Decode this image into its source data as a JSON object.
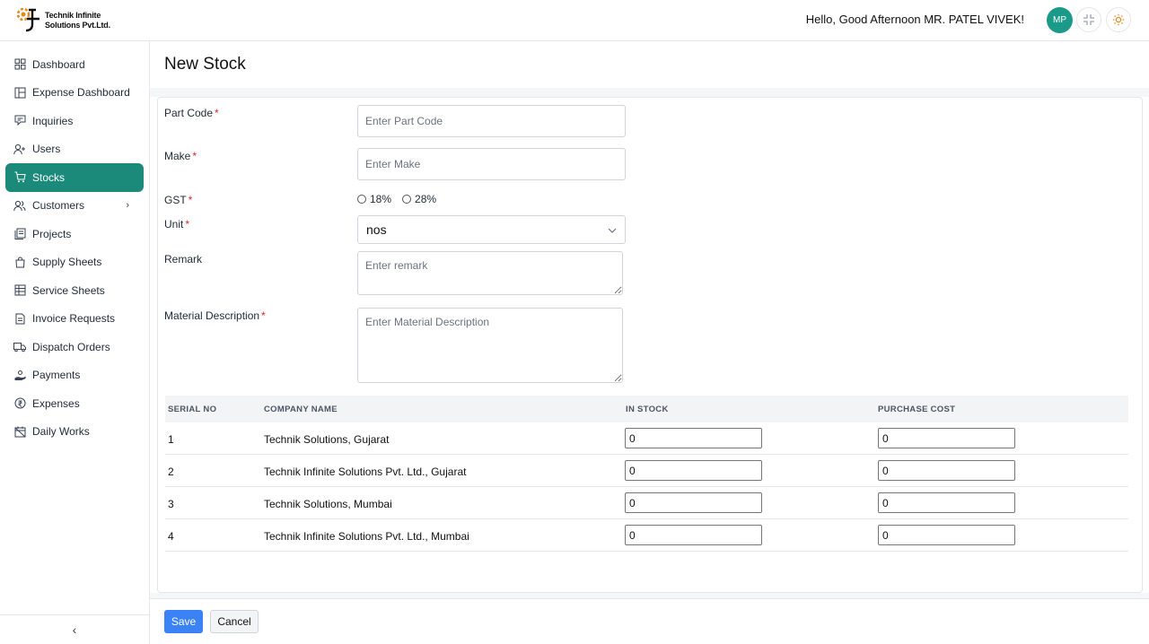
{
  "header": {
    "logo_line1": "Technik Infinite",
    "logo_line2": "Solutions Pvt.Ltd.",
    "greeting": "Hello, Good Afternoon MR. PATEL VIVEK!",
    "avatar_initials": "MP",
    "icons": [
      "minimize-icon",
      "sun-icon"
    ]
  },
  "sidebar": {
    "items": [
      {
        "label": "Dashboard",
        "icon": "grid-icon"
      },
      {
        "label": "Expense Dashboard",
        "icon": "layout-icon"
      },
      {
        "label": "Inquiries",
        "icon": "inquiry-icon"
      },
      {
        "label": "Users",
        "icon": "user-plus-icon"
      },
      {
        "label": "Stocks",
        "icon": "cart-icon",
        "active": true
      },
      {
        "label": "Customers",
        "icon": "users-icon",
        "has_submenu": true
      },
      {
        "label": "Projects",
        "icon": "projects-icon"
      },
      {
        "label": "Supply Sheets",
        "icon": "bag-icon"
      },
      {
        "label": "Service Sheets",
        "icon": "sheet-icon"
      },
      {
        "label": "Invoice Requests",
        "icon": "invoice-icon"
      },
      {
        "label": "Dispatch Orders",
        "icon": "truck-icon"
      },
      {
        "label": "Payments",
        "icon": "payment-icon"
      },
      {
        "label": "Expenses",
        "icon": "expense-icon"
      },
      {
        "label": "Daily Works",
        "icon": "calendar-icon"
      }
    ],
    "active_color": "#1b8a7a"
  },
  "page": {
    "title": "New Stock"
  },
  "form": {
    "part_code": {
      "label": "Part Code",
      "placeholder": "Enter Part Code",
      "value": ""
    },
    "make": {
      "label": "Make",
      "placeholder": "Enter Make",
      "value": ""
    },
    "gst": {
      "label": "GST",
      "options": [
        "18%",
        "28%"
      ],
      "selected": null
    },
    "unit": {
      "label": "Unit",
      "value": "nos"
    },
    "remark": {
      "label": "Remark",
      "placeholder": "Enter remark"
    },
    "material_description": {
      "label": "Material Description",
      "placeholder": "Enter Material Description"
    }
  },
  "table": {
    "headers": [
      "SERIAL NO",
      "COMPANY NAME",
      "IN STOCK",
      "PURCHASE COST"
    ],
    "rows": [
      {
        "serial": "1",
        "company": "Technik Solutions, Gujarat",
        "in_stock": "0",
        "purchase_cost": "0"
      },
      {
        "serial": "2",
        "company": "Technik Infinite Solutions Pvt. Ltd., Gujarat",
        "in_stock": "0",
        "purchase_cost": "0"
      },
      {
        "serial": "3",
        "company": "Technik Solutions, Mumbai",
        "in_stock": "0",
        "purchase_cost": "0"
      },
      {
        "serial": "4",
        "company": "Technik Infinite Solutions Pvt. Ltd., Mumbai",
        "in_stock": "0",
        "purchase_cost": "0"
      }
    ]
  },
  "actions": {
    "save_label": "Save",
    "cancel_label": "Cancel"
  },
  "colors": {
    "primary": "#3b82f6",
    "accent": "#1b8a7a",
    "avatar": "#1b9a8a",
    "required": "#dc2626"
  }
}
